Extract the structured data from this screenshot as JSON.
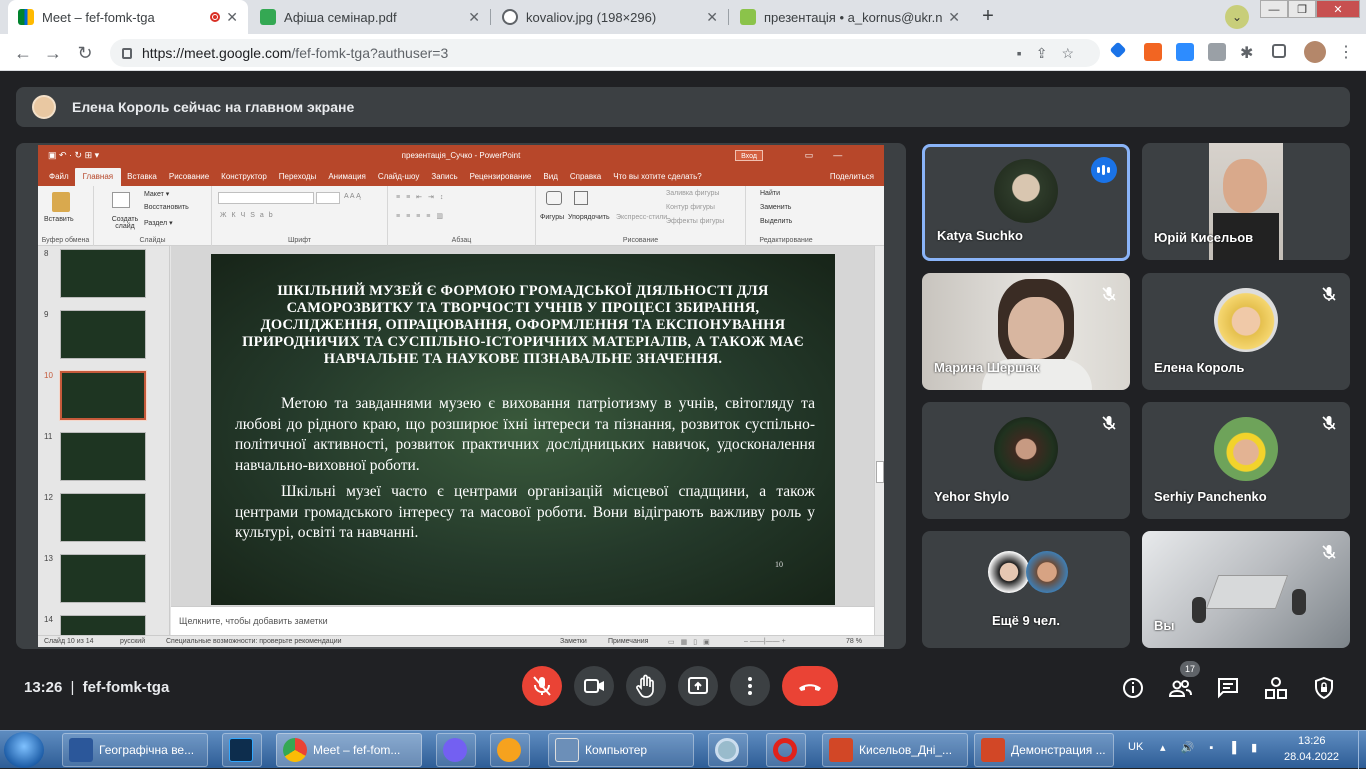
{
  "browser": {
    "tabs": [
      {
        "title": "Meet – fef-fomk-tga",
        "icon": "google-meet-icon",
        "recording": true
      },
      {
        "title": "Афіша семінар.pdf",
        "icon": "pdf-icon"
      },
      {
        "title": "kovaliov.jpg (198×296)",
        "icon": "globe-icon"
      },
      {
        "title": "презентація • a_kornus@ukr.net",
        "icon": "mail-icon"
      }
    ],
    "url_host": "https://meet.google.com",
    "url_path": "/fef-fomk-tga?authuser=3"
  },
  "meet": {
    "banner_text": "Елена Король сейчас на главном экране",
    "meeting_time": "13:26",
    "meeting_code": "fef-fomk-tga",
    "participant_count": "17",
    "participants": [
      {
        "name": "Katya Suchko",
        "speaking": true
      },
      {
        "name": "Юрій Кисельов"
      },
      {
        "name": "Марина Шершак"
      },
      {
        "name": "Елена Король"
      },
      {
        "name": "Yehor Shylo"
      },
      {
        "name": "Serhiy Panchenko"
      },
      {
        "name": "Ещё 9 чел."
      },
      {
        "name": "Вы"
      }
    ]
  },
  "powerpoint": {
    "window_title": "презентація_Сучко  -  PowerPoint",
    "enter_label": "Вход",
    "menu": [
      "Файл",
      "Главная",
      "Вставка",
      "Рисование",
      "Конструктор",
      "Переходы",
      "Анимация",
      "Слайд-шоу",
      "Запись",
      "Рецензирование",
      "Вид",
      "Справка",
      "Что вы хотите сделать?"
    ],
    "share_label": "Поделиться",
    "ribbon": {
      "paste": "Вставить",
      "clipboard": "Буфер обмена",
      "new_slide": "Создать слайд",
      "layout": "Макет",
      "reset": "Восстановить",
      "section": "Раздел",
      "slides": "Слайды",
      "font": "Шрифт",
      "paragraph": "Абзац",
      "shapes": "Фигуры",
      "arrange": "Упорядочить",
      "quick_styles": "Экспресс-стили",
      "fill": "Заливка фигуры",
      "outline": "Контур фигуры",
      "effects": "Эффекты фигуры",
      "drawing": "Рисование",
      "find": "Найти",
      "replace": "Заменить",
      "select": "Выделить",
      "editing": "Редактирование"
    },
    "thumb_numbers": [
      "8",
      "9",
      "10",
      "11",
      "12",
      "13",
      "14"
    ],
    "selected_slide": "10",
    "slide": {
      "heading": "ШКІЛЬНИЙ МУЗЕЙ Є ФОРМОЮ ГРОМАДСЬКОЇ ДІЯЛЬНОСТІ ДЛЯ САМОРОЗВИТКУ ТА ТВОРЧОСТІ УЧНІВ У ПРОЦЕСІ ЗБИРАННЯ, ДОСЛІДЖЕННЯ, ОПРАЦЮВАННЯ, ОФОРМЛЕННЯ ТА ЕКСПОНУВАННЯ ПРИРОДНИЧИХ ТА СУСПІЛЬНО-ІСТОРИЧНИХ МАТЕРІАЛІВ, А ТАКОЖ МАЄ НАВЧАЛЬНЕ ТА НАУКОВЕ ПІЗНАВАЛЬНЕ ЗНАЧЕННЯ.",
      "para1": "Метою та завданнями музею є виховання патріотизму в учнів, світогляду та любові до рідного краю, що розширює їхні інтереси та пізнання, розвиток суспільно-політичної активності, розвиток практичних дослідницьких навичок, удосконалення навчально-виховної роботи.",
      "para2": "Шкільні музеї часто є центрами організацій місцевої спадщини, а також центрами громадського інтересу та масової роботи. Вони відіграють важливу роль у культурі, освіті та навчанні.",
      "page_number": "10"
    },
    "notes_placeholder": "Щелкните, чтобы добавить заметки",
    "status": {
      "slide_of": "Слайд 10 из 14",
      "language": "русский",
      "accessibility": "Специальные возможности: проверьте рекомендации",
      "notes": "Заметки",
      "comments": "Примечания",
      "zoom": "78 %"
    }
  },
  "taskbar": {
    "items": [
      {
        "label": "Географічна ве...",
        "icon": "word-icon"
      },
      {
        "label": "",
        "icon": "photoshop-icon"
      },
      {
        "label": "Meet – fef-fom...",
        "icon": "chrome-icon"
      },
      {
        "label": "",
        "icon": "viber-icon"
      },
      {
        "label": "",
        "icon": "media-player-icon"
      },
      {
        "label": "Компьютер",
        "icon": "computer-icon"
      },
      {
        "label": "",
        "icon": "magnifier-icon"
      },
      {
        "label": "",
        "icon": "opera-icon"
      },
      {
        "label": "Кисельов_Дні_...",
        "icon": "powerpoint-icon"
      },
      {
        "label": "Демонстрация ...",
        "icon": "powerpoint-icon"
      }
    ],
    "lang": "UK",
    "time": "13:26",
    "date": "28.04.2022"
  }
}
